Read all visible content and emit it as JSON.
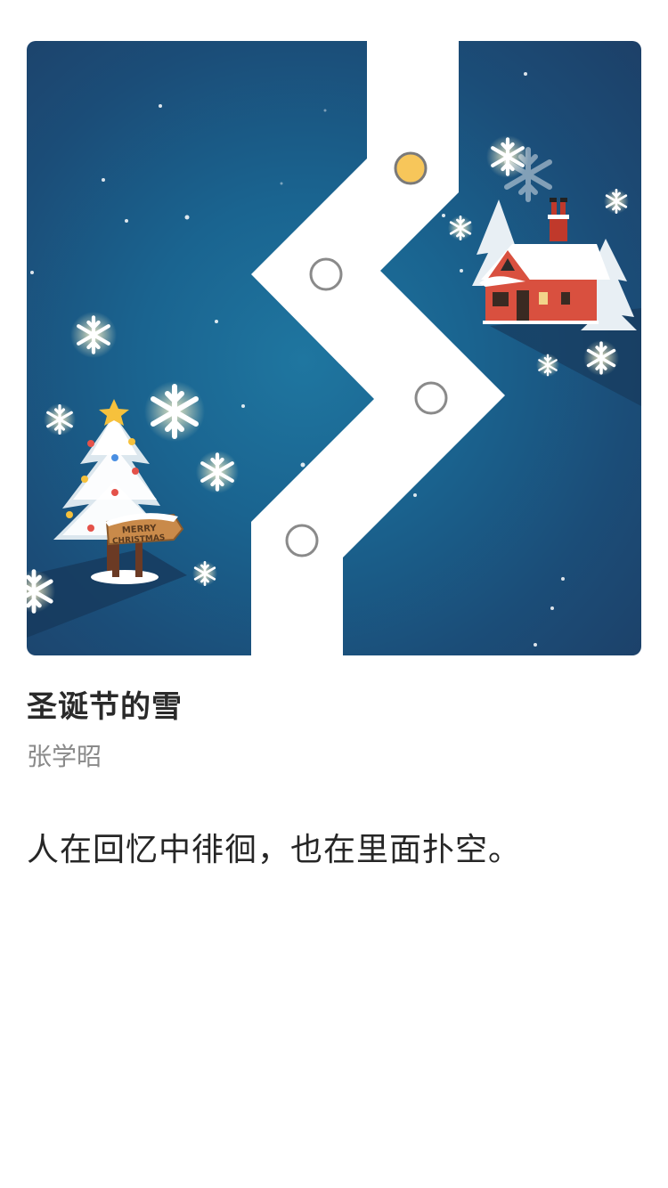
{
  "song": {
    "title": "圣诞节的雪",
    "artist": "张学昭",
    "quote": "人在回忆中徘徊，也在里面扑空。"
  },
  "cover": {
    "sign_line1": "MERRY",
    "sign_line2": "CHRISTMAS",
    "colors": {
      "sky": "#1b5c86",
      "path": "#ffffff",
      "active_dot": "#f7c65a",
      "house": "#d9503f"
    },
    "icons": [
      "snowflake-icon",
      "christmas-tree-icon",
      "house-icon",
      "santa-icon"
    ]
  }
}
